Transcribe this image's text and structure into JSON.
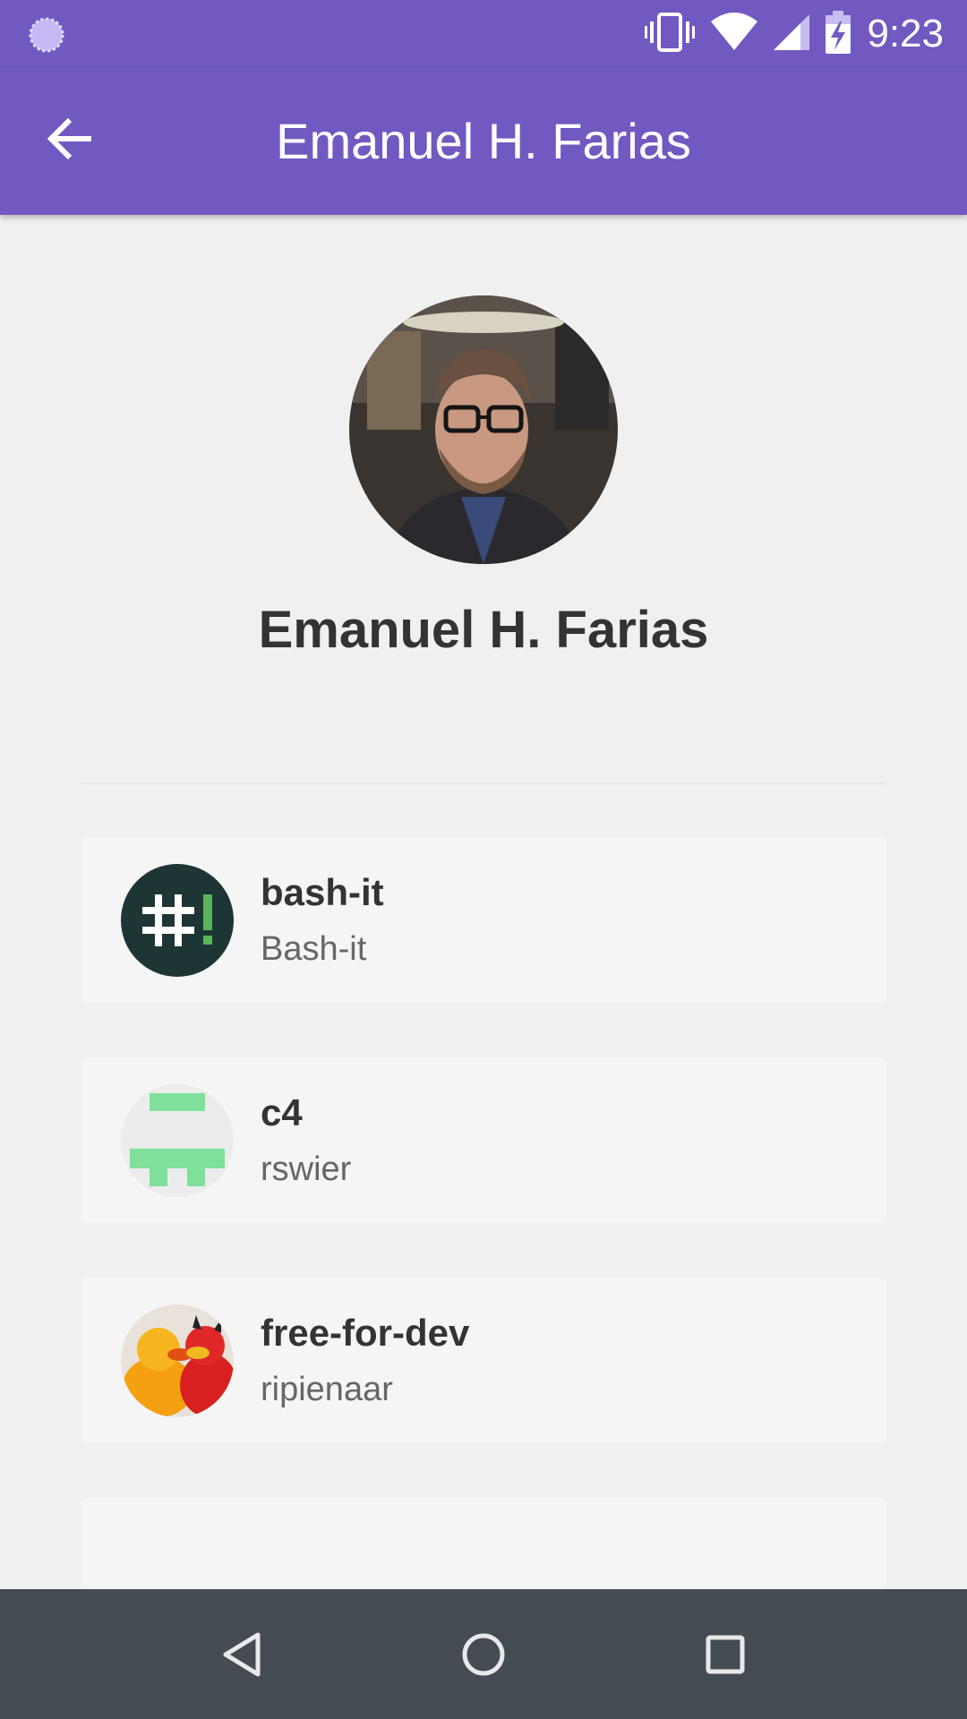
{
  "status_bar": {
    "time": "9:23",
    "icons": [
      "loading-spinner-icon",
      "vibrate-icon",
      "wifi-icon",
      "cellular-signal-icon",
      "battery-charging-icon"
    ]
  },
  "app_bar": {
    "title": "Emanuel H. Farias",
    "back_icon": "arrow-back-icon"
  },
  "profile": {
    "name": "Emanuel H. Farias",
    "avatar": "profile-photo"
  },
  "repos": [
    {
      "name": "bash-it",
      "owner": "Bash-it",
      "icon": "bash-it-logo"
    },
    {
      "name": "c4",
      "owner": "rswier",
      "icon": "identicon"
    },
    {
      "name": "free-for-dev",
      "owner": "ripienaar",
      "icon": "ducks-photo"
    }
  ],
  "nav_bar": {
    "icons": [
      "nav-back-icon",
      "nav-home-icon",
      "nav-recents-icon"
    ]
  },
  "colors": {
    "primary": "#7159c1",
    "nav_bar": "#444b52",
    "background": "#f0f0f0",
    "card": "#f5f5f5",
    "text_dark": "#333333",
    "text_muted": "#666666"
  }
}
